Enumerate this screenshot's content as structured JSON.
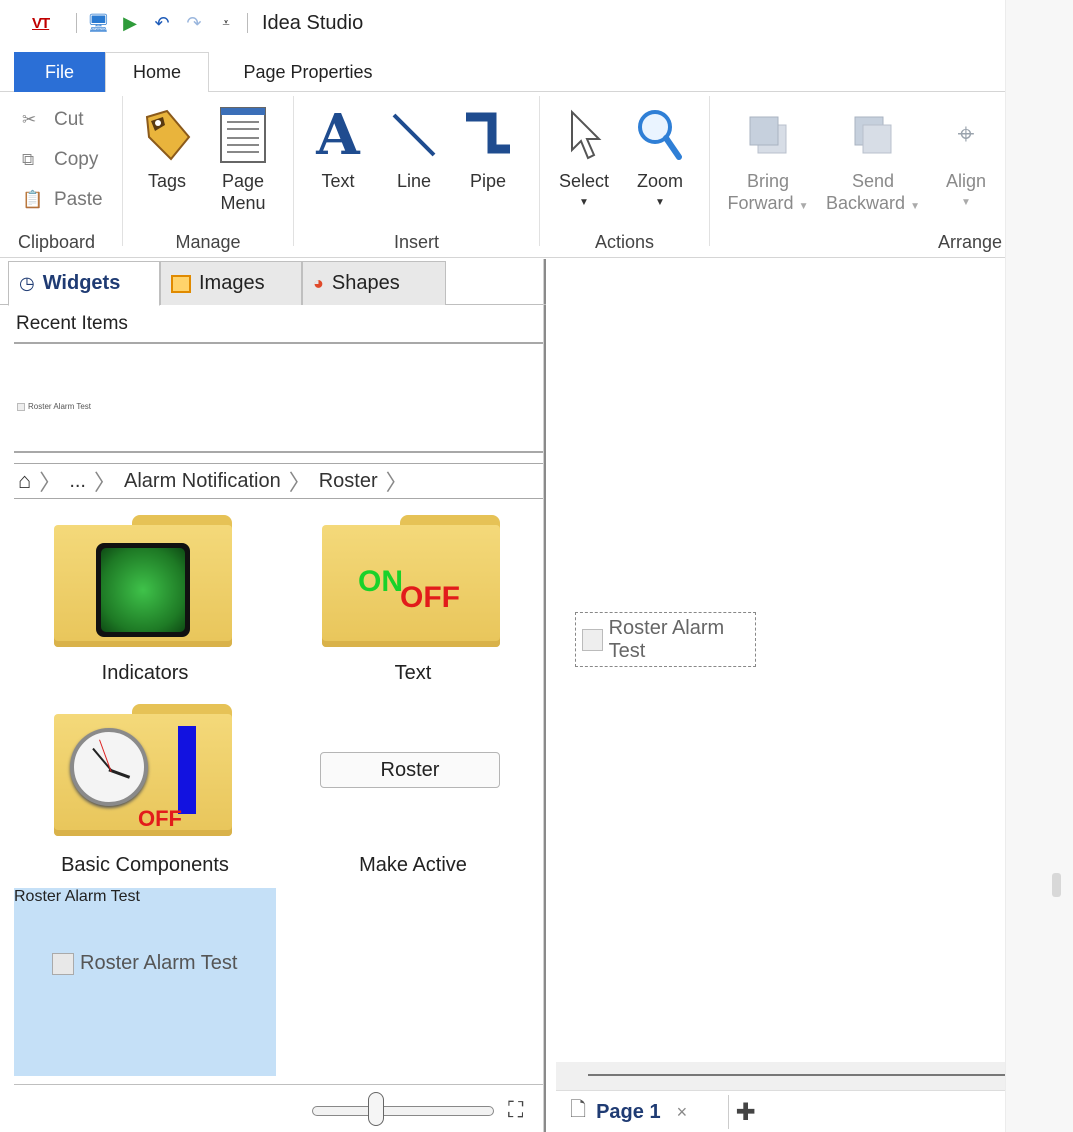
{
  "app": {
    "logo_text": "VT",
    "title": "Idea Studio"
  },
  "tabs": {
    "file": "File",
    "home": "Home",
    "page_properties": "Page Properties"
  },
  "ribbon": {
    "clipboard": {
      "cut": "Cut",
      "copy": "Copy",
      "paste": "Paste",
      "label": "Clipboard"
    },
    "manage": {
      "tags": "Tags",
      "page_menu_1": "Page",
      "page_menu_2": "Menu",
      "label": "Manage"
    },
    "insert": {
      "text": "Text",
      "line": "Line",
      "pipe": "Pipe",
      "label": "Insert"
    },
    "actions": {
      "select": "Select",
      "zoom": "Zoom",
      "label": "Actions"
    },
    "arrange": {
      "bring_forward_1": "Bring",
      "bring_forward_2": "Forward",
      "send_backward_1": "Send",
      "send_backward_2": "Backward",
      "align": "Align",
      "label": "Arrange"
    }
  },
  "left_panel": {
    "tabs": {
      "widgets": "Widgets",
      "images": "Images",
      "shapes": "Shapes"
    },
    "recent_header": "Recent Items",
    "recent_item": "Roster Alarm Test",
    "breadcrumb": {
      "ellipsis": "...",
      "level1": "Alarm Notification",
      "level2": "Roster"
    },
    "tiles": {
      "indicators": "Indicators",
      "text": "Text",
      "basic_components": "Basic Components",
      "make_active": "Make Active",
      "make_active_button": "Roster",
      "roster_alarm_test": "Roster Alarm Test",
      "roster_alarm_test_preview": "Roster Alarm Test",
      "text_folder_on": "ON",
      "text_folder_off": "OFF",
      "basic_folder_off": "OFF"
    }
  },
  "canvas": {
    "widget_label": "Roster Alarm Test"
  },
  "pagebar": {
    "page_name": "Page 1",
    "close": "×"
  },
  "colors": {
    "file_tab": "#2b6fd6",
    "selection": "#c5e0f7",
    "active_tab_text": "#1f3b73"
  }
}
